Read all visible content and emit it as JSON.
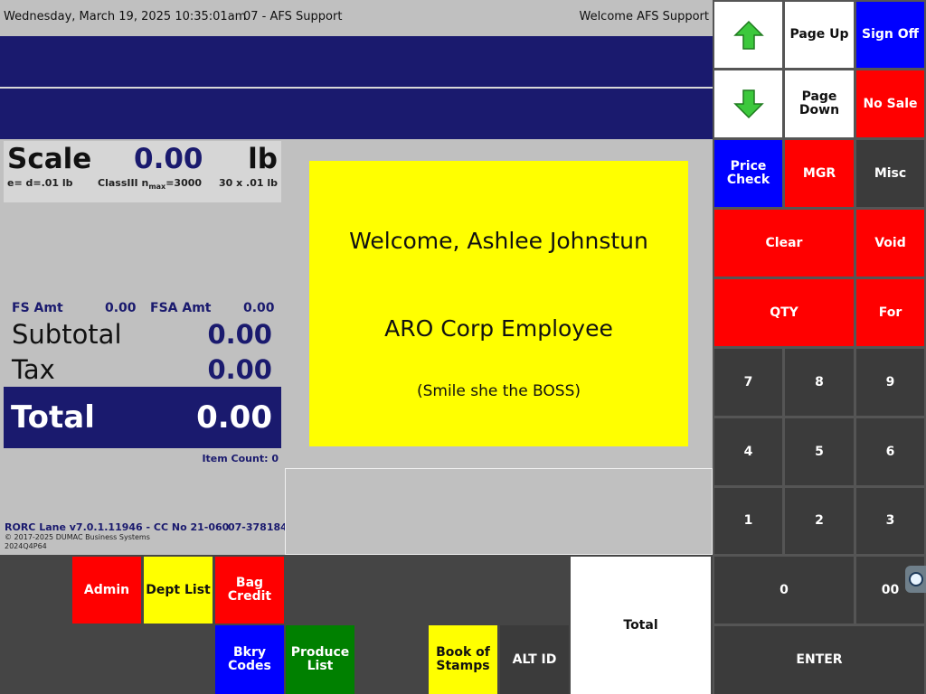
{
  "header": {
    "datetime": "Wednesday, March 19, 2025 10:35:01am",
    "lane": "07 - AFS Support",
    "welcome": "Welcome AFS Support"
  },
  "scale": {
    "label": "Scale",
    "value": "0.00",
    "unit": "lb",
    "sub_left": "e= d=.01 lb",
    "sub_mid": "ClassIII n",
    "sub_mid_subscript": "max",
    "sub_mid_tail": "=3000",
    "sub_right": "30 x .01 lb"
  },
  "amounts": {
    "fs_label": "FS Amt",
    "fs_value": "0.00",
    "fsa_label": "FSA Amt",
    "fsa_value": "0.00",
    "subtotal_label": "Subtotal",
    "subtotal_value": "0.00",
    "tax_label": "Tax",
    "tax_value": "0.00",
    "total_label": "Total",
    "total_value": "0.00",
    "item_count": "Item Count: 0"
  },
  "footer": {
    "version": "RORC Lane v7.0.1.11946 - CC No 21-060",
    "version_id": "07-378184",
    "copyright": "© 2017-2025 DUMAC Business Systems",
    "build": "2024Q4P64"
  },
  "welcome_panel": {
    "line1": "Welcome, Ashlee Johnstun",
    "line2": "ARO Corp Employee",
    "line3": "(Smile she the BOSS)"
  },
  "bottom_buttons": {
    "admin": "Admin",
    "dept_list": "Dept List",
    "bag_credit": "Bag Credit",
    "bkry_codes_1": "Bkry",
    "bkry_codes_2": "Codes",
    "produce_list_1": "Produce",
    "produce_list_2": "List",
    "book_of_stamps_1": "Book of",
    "book_of_stamps_2": "Stamps",
    "alt_id": "ALT ID",
    "total": "Total"
  },
  "right_panel": {
    "page_up": "Page Up",
    "sign_off": "Sign Off",
    "page_down_1": "Page",
    "page_down_2": "Down",
    "no_sale": "No Sale",
    "price_check_1": "Price",
    "price_check_2": "Check",
    "mgr": "MGR",
    "misc": "Misc",
    "clear": "Clear",
    "void": "Void",
    "qty": "QTY",
    "for": "For",
    "keys": [
      "7",
      "8",
      "9",
      "4",
      "5",
      "6",
      "1",
      "2",
      "3"
    ],
    "zero": "0",
    "double_zero": "00",
    "enter": "ENTER"
  },
  "icons": {
    "up_arrow": "green-up-arrow-icon",
    "down_arrow": "green-down-arrow-icon",
    "scroll_tab": "side-tab-icon"
  },
  "colors": {
    "navy": "#1a1a6e",
    "red": "#ff0000",
    "blue": "#0000ff",
    "yellow": "#ffff00",
    "green": "#008000",
    "arrow_green": "#3cc83c"
  }
}
